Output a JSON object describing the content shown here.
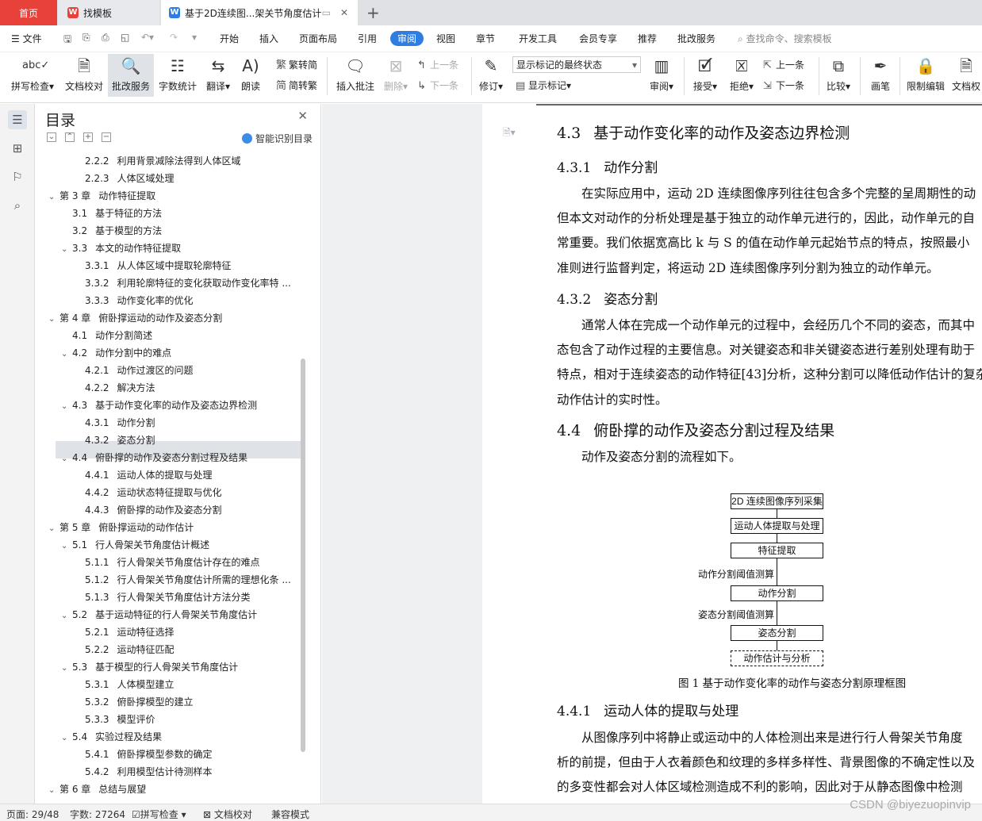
{
  "tabs": {
    "home": "首页",
    "template": "找模板",
    "document": "基于2D连续图...架关节角度估计"
  },
  "menu": {
    "file": "文件",
    "items": [
      "开始",
      "插入",
      "页面布局",
      "引用",
      "审阅",
      "视图",
      "章节",
      "开发工具",
      "会员专享",
      "推荐",
      "批改服务"
    ],
    "search": "查找命令、搜索模板"
  },
  "ribbon": {
    "spell": "拼写检查",
    "proof": "文档校对",
    "correct": "批改服务",
    "count": "字数统计",
    "translate": "翻译",
    "read": "朗读",
    "trad": "繁转简",
    "simp": "简转繁",
    "insert_comment": "插入批注",
    "delete": "删除",
    "prev": "上一条",
    "next": "下一条",
    "revise": "修订",
    "markup_state": "显示标记的最终状态",
    "show_markup": "显示标记",
    "review": "审阅",
    "accept": "接受",
    "reject": "拒绝",
    "prev2": "上一条",
    "next2": "下一条",
    "compare": "比较",
    "pen": "画笔",
    "restrict": "限制编辑",
    "docperm": "文档权"
  },
  "toc": {
    "title": "目录",
    "smart": "智能识别目录",
    "items": [
      {
        "num": "2.2.2",
        "text": "利用背景减除法得到人体区域",
        "level": 3
      },
      {
        "num": "2.2.3",
        "text": "人体区域处理",
        "level": 3
      },
      {
        "num": "第 3 章",
        "text": "动作特征提取",
        "level": 1
      },
      {
        "num": "3.1",
        "text": "基于特征的方法",
        "level": 2
      },
      {
        "num": "3.2",
        "text": "基于模型的方法",
        "level": 2
      },
      {
        "num": "3.3",
        "text": "本文的动作特征提取",
        "level": 2,
        "exp": true
      },
      {
        "num": "3.3.1",
        "text": "从人体区域中提取轮廓特征",
        "level": 3
      },
      {
        "num": "3.3.2",
        "text": "利用轮廓特征的变化获取动作变化率特 ...",
        "level": 3
      },
      {
        "num": "3.3.3",
        "text": "动作变化率的优化",
        "level": 3
      },
      {
        "num": "第 4 章",
        "text": "俯卧撑运动的动作及姿态分割",
        "level": 1
      },
      {
        "num": "4.1",
        "text": "动作分割简述",
        "level": 2
      },
      {
        "num": "4.2",
        "text": "动作分割中的难点",
        "level": 2,
        "exp": true
      },
      {
        "num": "4.2.1",
        "text": "动作过渡区的问题",
        "level": 3
      },
      {
        "num": "4.2.2",
        "text": "解决方法",
        "level": 3
      },
      {
        "num": "4.3",
        "text": "基于动作变化率的动作及姿态边界检测",
        "level": 2,
        "exp": true
      },
      {
        "num": "4.3.1",
        "text": "动作分割",
        "level": 3
      },
      {
        "num": "4.3.2",
        "text": "姿态分割",
        "level": 3
      },
      {
        "num": "4.4",
        "text": "俯卧撑的动作及姿态分割过程及结果",
        "level": 2,
        "exp": true
      },
      {
        "num": "4.4.1",
        "text": "运动人体的提取与处理",
        "level": 3
      },
      {
        "num": "4.4.2",
        "text": "运动状态特征提取与优化",
        "level": 3
      },
      {
        "num": "4.4.3",
        "text": "俯卧撑的动作及姿态分割",
        "level": 3
      },
      {
        "num": "第 5 章",
        "text": "俯卧撑运动的动作估计",
        "level": 1
      },
      {
        "num": "5.1",
        "text": "行人骨架关节角度估计概述",
        "level": 2,
        "exp": true
      },
      {
        "num": "5.1.1",
        "text": "行人骨架关节角度估计存在的难点",
        "level": 3
      },
      {
        "num": "5.1.2",
        "text": "行人骨架关节角度估计所需的理想化条 ...",
        "level": 3
      },
      {
        "num": "5.1.3",
        "text": "行人骨架关节角度估计方法分类",
        "level": 3
      },
      {
        "num": "5.2",
        "text": "基于运动特征的行人骨架关节角度估计",
        "level": 2,
        "exp": true
      },
      {
        "num": "5.2.1",
        "text": "运动特征选择",
        "level": 3
      },
      {
        "num": "5.2.2",
        "text": "运动特征匹配",
        "level": 3
      },
      {
        "num": "5.3",
        "text": "基于模型的行人骨架关节角度估计",
        "level": 2,
        "exp": true
      },
      {
        "num": "5.3.1",
        "text": "人体模型建立",
        "level": 3
      },
      {
        "num": "5.3.2",
        "text": "俯卧撑模型的建立",
        "level": 3
      },
      {
        "num": "5.3.3",
        "text": "模型评价",
        "level": 3
      },
      {
        "num": "5.4",
        "text": "实验过程及结果",
        "level": 2,
        "exp": true
      },
      {
        "num": "5.4.1",
        "text": "俯卧撑模型参数的确定",
        "level": 3
      },
      {
        "num": "5.4.2",
        "text": "利用模型估计待测样本",
        "level": 3
      },
      {
        "num": "第 6 章",
        "text": "总结与展望",
        "level": 1
      }
    ]
  },
  "doc": {
    "h_4_3": {
      "num": "4.3",
      "text": "基于动作变化率的动作及姿态边界检测"
    },
    "h_4_3_1": {
      "num": "4.3.1",
      "text": "动作分割"
    },
    "p1": [
      "在实际应用中，运动 2D 连续图像序列往往包含多个完整的呈周期性的动",
      "但本文对动作的分析处理是基于独立的动作单元进行的，因此，动作单元的自",
      "常重要。我们依据宽高比 k 与 S  的值在动作单元起始节点的特点，按照最小",
      "准则进行监督判定，将运动 2D 连续图像序列分割为独立的动作单元。"
    ],
    "h_4_3_2": {
      "num": "4.3.2",
      "text": "姿态分割"
    },
    "p2": [
      "通常人体在完成一个动作单元的过程中，会经历几个不同的姿态，而其中",
      "态包含了动作过程的主要信息。对关键姿态和非关键姿态进行差别处理有助于",
      "特点，相对于连续姿态的动作特征[43]分析，这种分割可以降低动作估计的复杂",
      "动作估计的实时性。"
    ],
    "h_4_4": {
      "num": "4.4",
      "text": "俯卧撑的动作及姿态分割过程及结果"
    },
    "p3": "动作及姿态分割的流程如下。",
    "flow": {
      "b1": "2D 连续图像序列采集",
      "b2": "运动人体提取与处理",
      "b3": "特征提取",
      "l1": "动作分割阈值测算",
      "b4": "动作分割",
      "l2": "姿态分割阈值测算",
      "b5": "姿态分割",
      "b6": "动作估计与分析"
    },
    "caption": "图 1  基于动作变化率的动作与姿态分割原理框图",
    "h_4_4_1": {
      "num": "4.4.1",
      "text": "运动人体的提取与处理"
    },
    "p4": [
      "从图像序列中将静止或运动中的人体检测出来是进行行人骨架关节角度",
      "析的前提，但由于人衣着颜色和纹理的多样多样性、背景图像的不确定性以及",
      "的多变性都会对人体区域检测造成不利的影响，因此对于从静态图像中检测"
    ]
  },
  "status": {
    "page": "页面: 29/48",
    "words": "字数: 27264",
    "spell": "拼写检查",
    "proof": "文档校对",
    "compat": "兼容模式",
    "watermark": "CSDN @biyezuopinvip"
  },
  "colors": {
    "accent": "#2f7de1",
    "home_tab": "#e8413a"
  }
}
